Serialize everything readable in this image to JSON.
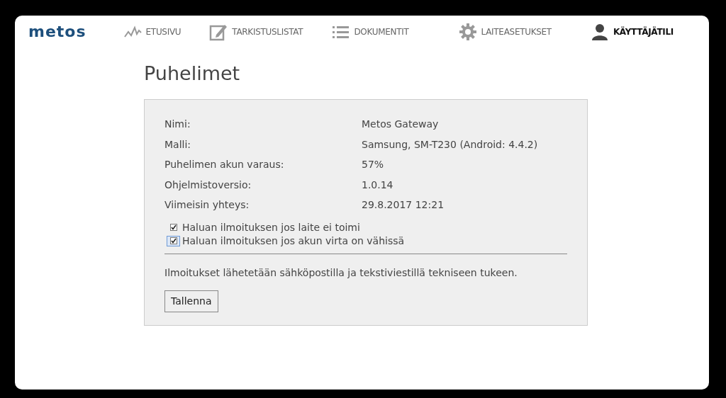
{
  "logo": "metos",
  "nav": [
    {
      "label": "ETUSIVU",
      "kind": "chart",
      "selected": false
    },
    {
      "label": "TARKISTUSLISTAT",
      "kind": "edit",
      "selected": false
    },
    {
      "label": "DOKUMENTIT",
      "kind": "list",
      "selected": false
    },
    {
      "label": "LAITEASETUKSET",
      "kind": "gear",
      "selected": false
    },
    {
      "label": "KÄYTTÄJÄTILI",
      "kind": "user",
      "selected": true
    }
  ],
  "title": "Puhelimet",
  "details": [
    {
      "label": "Nimi:",
      "value": "Metos Gateway"
    },
    {
      "label": "Malli:",
      "value": "Samsung, SM-T230 (Android: 4.4.2)"
    },
    {
      "label": "Puhelimen akun varaus:",
      "value": "57%"
    },
    {
      "label": "Ohjelmistoversio:",
      "value": "1.0.14"
    },
    {
      "label": "Viimeisin yhteys:",
      "value": "29.8.2017 12:21"
    }
  ],
  "options": [
    {
      "label": "Haluan ilmoituksen jos laite ei toimi",
      "checked": true,
      "focused": false
    },
    {
      "label": "Haluan ilmoituksen jos akun virta on vähissä",
      "checked": true,
      "focused": true
    }
  ],
  "note": "Ilmoitukset lähetetään sähköpostilla ja tekstiviestillä tekniseen tukeen.",
  "save_button": "Tallenna"
}
